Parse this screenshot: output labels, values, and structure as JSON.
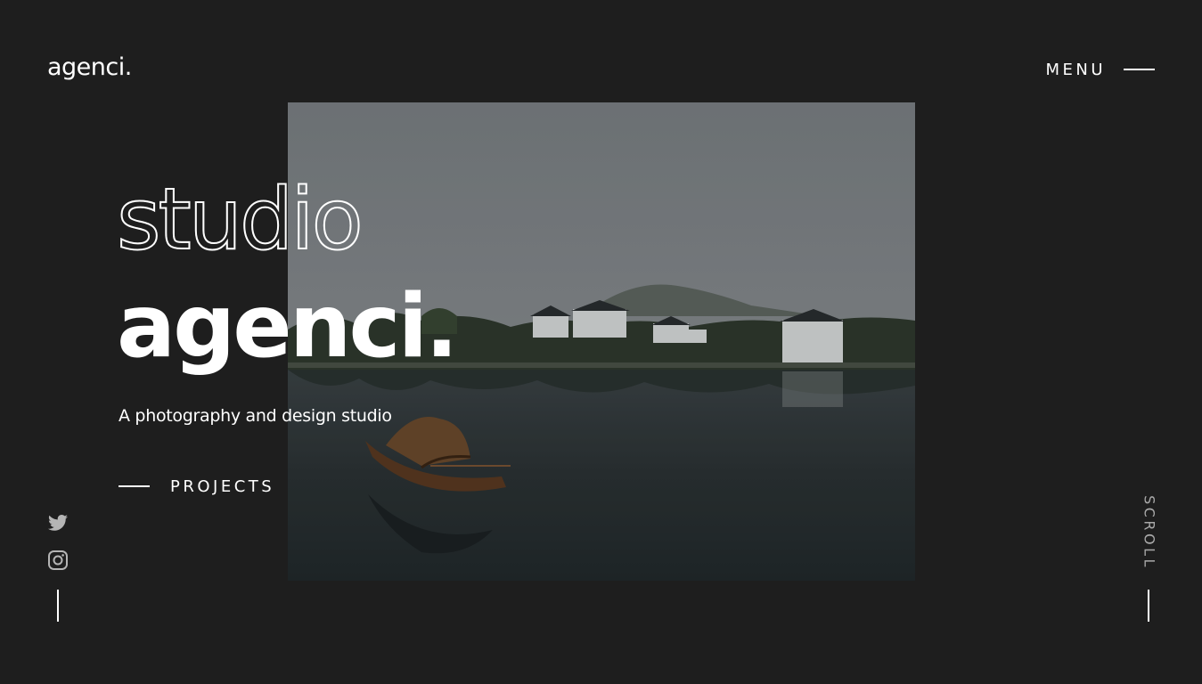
{
  "header": {
    "logo": "agenci.",
    "menu_label": "MENU"
  },
  "hero": {
    "outline_word": "studio",
    "title": "agenci.",
    "tagline": "A photography and design studio",
    "projects_label": "PROJECTS",
    "photo_subject": "lake-with-boat-and-village"
  },
  "social": {
    "icons": [
      "twitter-icon",
      "instagram-icon"
    ]
  },
  "scroll": {
    "label": "SCROLL"
  },
  "colors": {
    "background": "#1e1e1e",
    "text": "#ffffff",
    "muted": "#a9a9a9"
  }
}
